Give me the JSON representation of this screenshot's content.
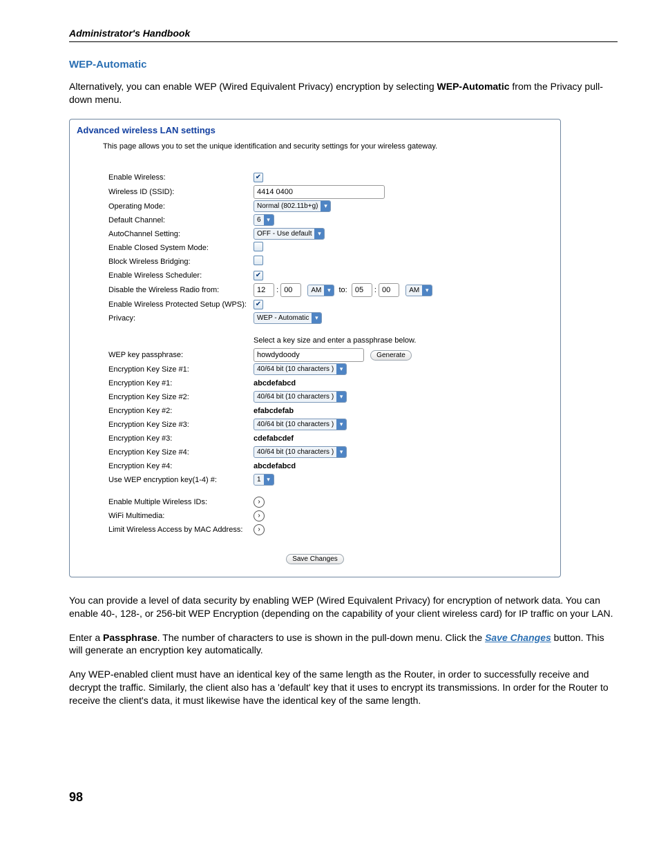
{
  "header": {
    "running": "Administrator's Handbook"
  },
  "page_number": "98",
  "section_title": "WEP-Automatic",
  "intro": {
    "before_bold": "Alternatively, you can enable WEP (Wired Equivalent Privacy) encryption by selecting ",
    "bold": "WEP-Automatic",
    "after_bold": " from the Privacy pull-down menu."
  },
  "panel": {
    "title": "Advanced wireless LAN settings",
    "description": "This page allows you to set the unique identification and security settings for your wireless gateway.",
    "labels": {
      "enable_wireless": "Enable Wireless:",
      "ssid": "Wireless ID (SSID):",
      "operating_mode": "Operating Mode:",
      "default_channel": "Default Channel:",
      "autochannel": "AutoChannel Setting:",
      "closed_system": "Enable Closed System Mode:",
      "block_bridging": "Block Wireless Bridging:",
      "scheduler": "Enable Wireless Scheduler:",
      "disable_radio": "Disable the Wireless Radio from:",
      "wps": "Enable Wireless Protected Setup (WPS):",
      "privacy": "Privacy:",
      "passphrase_prompt": "Select a key size and enter a passphrase below.",
      "wep_passphrase": "WEP key passphrase:",
      "ksize1": "Encryption Key Size #1:",
      "key1": "Encryption Key #1:",
      "ksize2": "Encryption Key Size #2:",
      "key2": "Encryption Key #2:",
      "ksize3": "Encryption Key Size #3:",
      "key3": "Encryption Key #3:",
      "ksize4": "Encryption Key Size #4:",
      "key4": "Encryption Key #4:",
      "use_key": "Use WEP encryption key(1-4) #:",
      "multi_ssid": "Enable Multiple Wireless IDs:",
      "wmm": "WiFi Multimedia:",
      "mac_limit": "Limit Wireless Access by MAC Address:"
    },
    "values": {
      "ssid": "4414 0400",
      "operating_mode": "Normal (802.11b+g)",
      "default_channel": "6",
      "autochannel": "OFF - Use default",
      "privacy": "WEP - Automatic",
      "passphrase": "howdydoody",
      "ksize": "40/64 bit (10 characters )",
      "key1": "abcdefabcd",
      "key2": "efabcdefab",
      "key3": "cdefabcdef",
      "key4": "abcdefabcd",
      "use_key": "1",
      "from_h": "12",
      "from_m": "00",
      "from_ampm": "AM",
      "to_lbl": "to:",
      "to_h": "05",
      "to_m": "00",
      "to_ampm": "AM",
      "colon": ":"
    },
    "buttons": {
      "generate": "Generate",
      "save": "Save Changes"
    }
  },
  "paras": {
    "p1": "You can provide a level of data security by enabling WEP (Wired Equivalent Privacy) for encryption of network data. You can enable 40-, 128-, or 256-bit WEP Encryption (depending on the capability of your client wireless card) for IP traffic on your LAN.",
    "p2_a": "Enter a ",
    "p2_bold1": "Passphrase",
    "p2_b": ". The number of characters to use is shown in the pull-down menu. Click the ",
    "p2_link": "Save Changes",
    "p2_c": " button. This will generate an encryption key automatically.",
    "p3": "Any WEP-enabled client must have an identical key of the same length as the Router, in order to successfully receive and decrypt the traffic. Similarly, the client also has a 'default' key that it uses to encrypt its transmissions. In order for the Router to receive the client's data, it must likewise have the identical key of the same length."
  }
}
